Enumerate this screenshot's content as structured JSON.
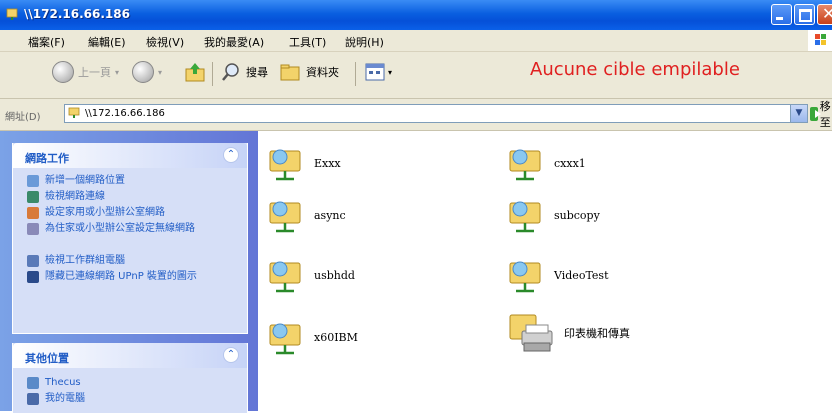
{
  "window": {
    "title": "\\\\172.16.66.186"
  },
  "menu": {
    "items": [
      "檔案(F)",
      "編輯(E)",
      "檢視(V)",
      "我的最愛(A)",
      "工具(T)",
      "說明(H)"
    ]
  },
  "toolbar": {
    "back_label": "上一頁",
    "search_label": "搜尋",
    "folders_label": "資料夾"
  },
  "overlay_text": "Aucune cible empilable",
  "address": {
    "label": "網址(D)",
    "value": "\\\\172.16.66.186",
    "go_label": "移至"
  },
  "left_pane": {
    "network_tasks": {
      "title": "網路工作",
      "items": [
        "新增一個網路位置",
        "檢視網路連線",
        "設定家用或小型辦公室網路",
        "為住家或小型辦公室設定無線網路",
        "檢視工作群組電腦",
        "隱藏已連線網路 UPnP 裝置的圖示"
      ]
    },
    "other_places": {
      "title": "其他位置",
      "items": [
        "Thecus",
        "我的電腦"
      ]
    }
  },
  "files": [
    {
      "name": "Exxx",
      "type": "share"
    },
    {
      "name": "cxxx1",
      "type": "share"
    },
    {
      "name": "async",
      "type": "share"
    },
    {
      "name": "subcopy",
      "type": "share"
    },
    {
      "name": "usbhdd",
      "type": "share"
    },
    {
      "name": "VideoTest",
      "type": "share"
    },
    {
      "name": "x60IBM",
      "type": "share"
    },
    {
      "name": "印表機和傳真",
      "type": "printers"
    }
  ],
  "colors": {
    "title_bar": "#0a5fe0",
    "task_pane": "#6375d6",
    "link": "#215dc6",
    "overlay": "#e02020"
  }
}
